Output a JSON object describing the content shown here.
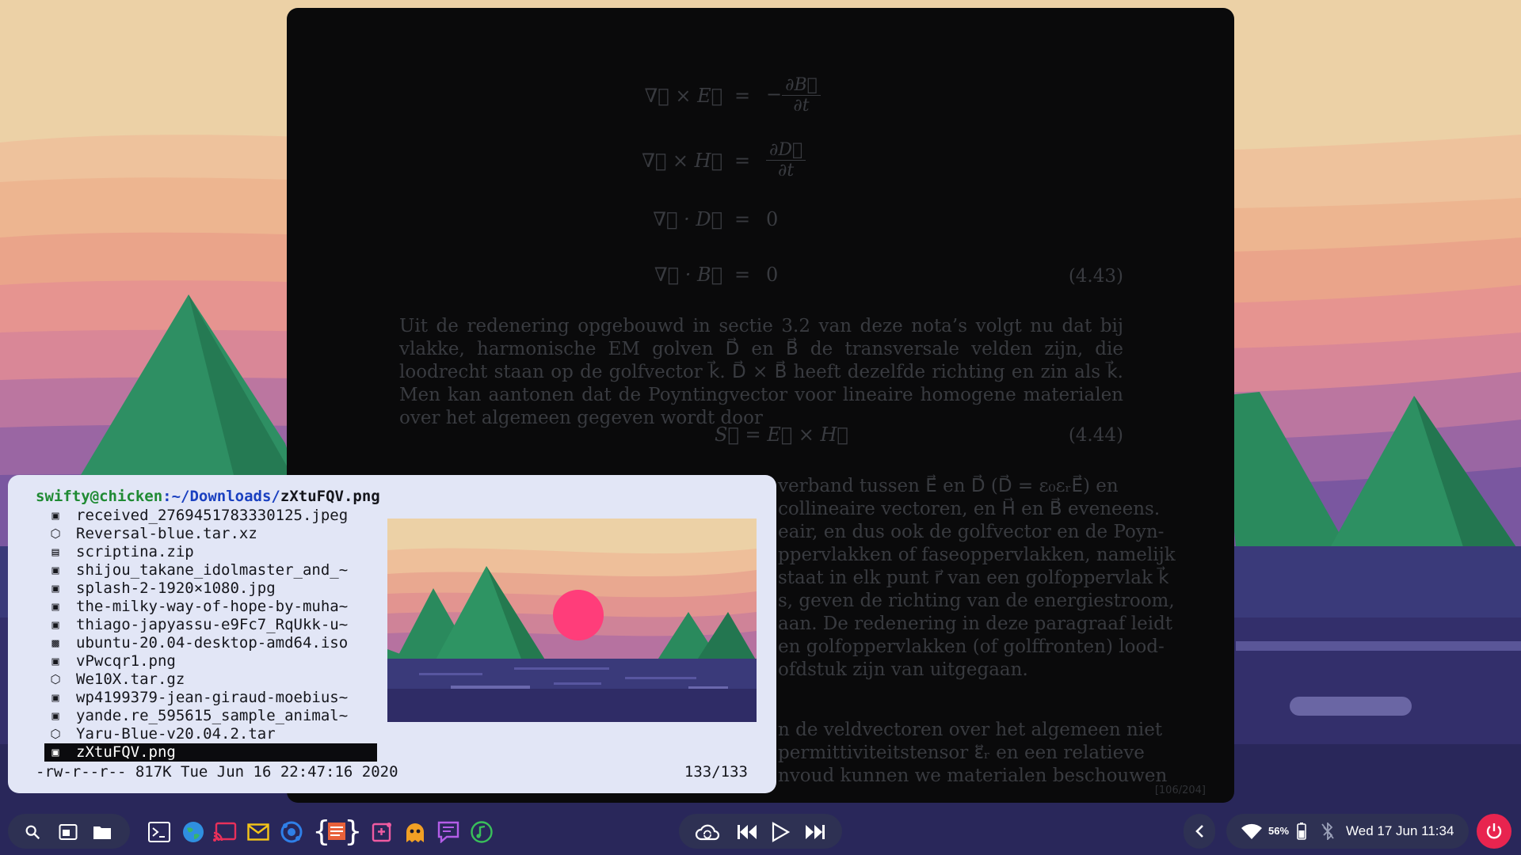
{
  "pdf": {
    "equations": [
      {
        "lhs": "∇⃗ × E⃗",
        "op": "=",
        "rhs_prefix": "−",
        "rhs_num": "∂B⃗",
        "rhs_den": "∂t",
        "number": ""
      },
      {
        "lhs": "∇⃗ × H⃗",
        "op": "=",
        "rhs_prefix": "",
        "rhs_num": "∂D⃗",
        "rhs_den": "∂t",
        "number": ""
      },
      {
        "lhs": "∇⃗ · D⃗",
        "op": "=",
        "rhs": "0",
        "number": ""
      },
      {
        "lhs": "∇⃗ · B⃗",
        "op": "=",
        "rhs": "0",
        "number": "(4.43)"
      }
    ],
    "paragraph1": "Uit de redenering opgebouwd in sectie 3.2 van deze nota’s volgt nu dat bij vlakke, harmonische EM golven D⃗ en B⃗ de transversale velden zijn, die loodrecht staan op de golfvector k⃗. D⃗ × B⃗ heeft dezelfde richting en zin als k⃗. Men kan aantonen dat de Poyntingvector voor lineaire homogene materialen over het algemeen gegeven wordt door",
    "equation2": "S⃗ = E⃗ × H⃗",
    "equation2_number": "(4.44)",
    "partial_lines": [
      "verband tussen E⃗ en D⃗ (D⃗ = ε₀εᵣE⃗) en",
      "collineaire vectoren, en H⃗ en B⃗ eveneens.",
      "eair, en dus ook de golfvector en de Poyn-",
      "ppervlakken of faseoppervlakken, namelijk",
      "staat in elk punt r⃗ van een golfoppervlak k⃗",
      "s, geven de richting van de energiestroom,",
      "aan. De redenering in deze paragraaf leidt",
      "en golfoppervlakken (of golffronten) lood-",
      "ofdstuk zijn van uitgegaan."
    ],
    "partial_lines2": [
      "n de veldvectoren over het algemeen niet",
      "permittiviteitstensor ε⃡ᵣ en een relatieve",
      "nvoud kunnen we materialen beschouwen"
    ],
    "page_indicator": "[106/204]"
  },
  "terminal": {
    "prompt_user": "swifty@chicken",
    "prompt_path": ":~/Downloads/",
    "prompt_file": "zXtuFQV.png",
    "files": [
      {
        "icon": "image-icon",
        "glyph": "▣",
        "name": "received_2769451783330125.jpeg",
        "selected": false
      },
      {
        "icon": "package-icon",
        "glyph": "⬡",
        "name": "Reversal-blue.tar.xz",
        "selected": false
      },
      {
        "icon": "zip-icon",
        "glyph": "▤",
        "name": "scriptina.zip",
        "selected": false
      },
      {
        "icon": "image-icon",
        "glyph": "▣",
        "name": "shijou_takane_idolmaster_and_~",
        "selected": false
      },
      {
        "icon": "image-icon",
        "glyph": "▣",
        "name": "splash-2-1920×1080.jpg",
        "selected": false
      },
      {
        "icon": "image-icon",
        "glyph": "▣",
        "name": "the-milky-way-of-hope-by-muha~",
        "selected": false
      },
      {
        "icon": "image-icon",
        "glyph": "▣",
        "name": "thiago-japyassu-e9Fc7_RqUkk-u~",
        "selected": false
      },
      {
        "icon": "disk-icon",
        "glyph": "▩",
        "name": "ubuntu-20.04-desktop-amd64.iso",
        "selected": false
      },
      {
        "icon": "image-icon",
        "glyph": "▣",
        "name": "vPwcqr1.png",
        "selected": false
      },
      {
        "icon": "package-icon",
        "glyph": "⬡",
        "name": "We10X.tar.gz",
        "selected": false
      },
      {
        "icon": "image-icon",
        "glyph": "▣",
        "name": "wp4199379-jean-giraud-moebius~",
        "selected": false
      },
      {
        "icon": "image-icon",
        "glyph": "▣",
        "name": "yande.re_595615_sample_animal~",
        "selected": false
      },
      {
        "icon": "package-icon",
        "glyph": "⬡",
        "name": "Yaru-Blue-v20.04.2.tar",
        "selected": false
      },
      {
        "icon": "image-icon",
        "glyph": "▣",
        "name": "zXtuFQV.png",
        "selected": true
      }
    ],
    "status_left": "-rw-r--r-- 817K Tue Jun 16 22:47:16 2020",
    "status_right": "133/133"
  },
  "taskbar": {
    "left_icons": [
      "search-icon",
      "window-overview-icon",
      "folder-icon"
    ],
    "apps": [
      "terminal-icon",
      "browser-icon",
      "cast-icon",
      "mail-icon",
      "sync-icon",
      "code-editor-icon",
      "screenshot-icon",
      "ghost-icon",
      "chat-icon",
      "music-icon"
    ],
    "media": [
      "cloud-sync-icon",
      "previous-track-icon",
      "play-icon",
      "next-track-icon"
    ],
    "battery": "56%",
    "clock": "Wed 17 Jun 11:34",
    "colors": {
      "panel": "#2e3153",
      "power": "#e8244f",
      "accent_sun": "#ff3d7a"
    }
  }
}
